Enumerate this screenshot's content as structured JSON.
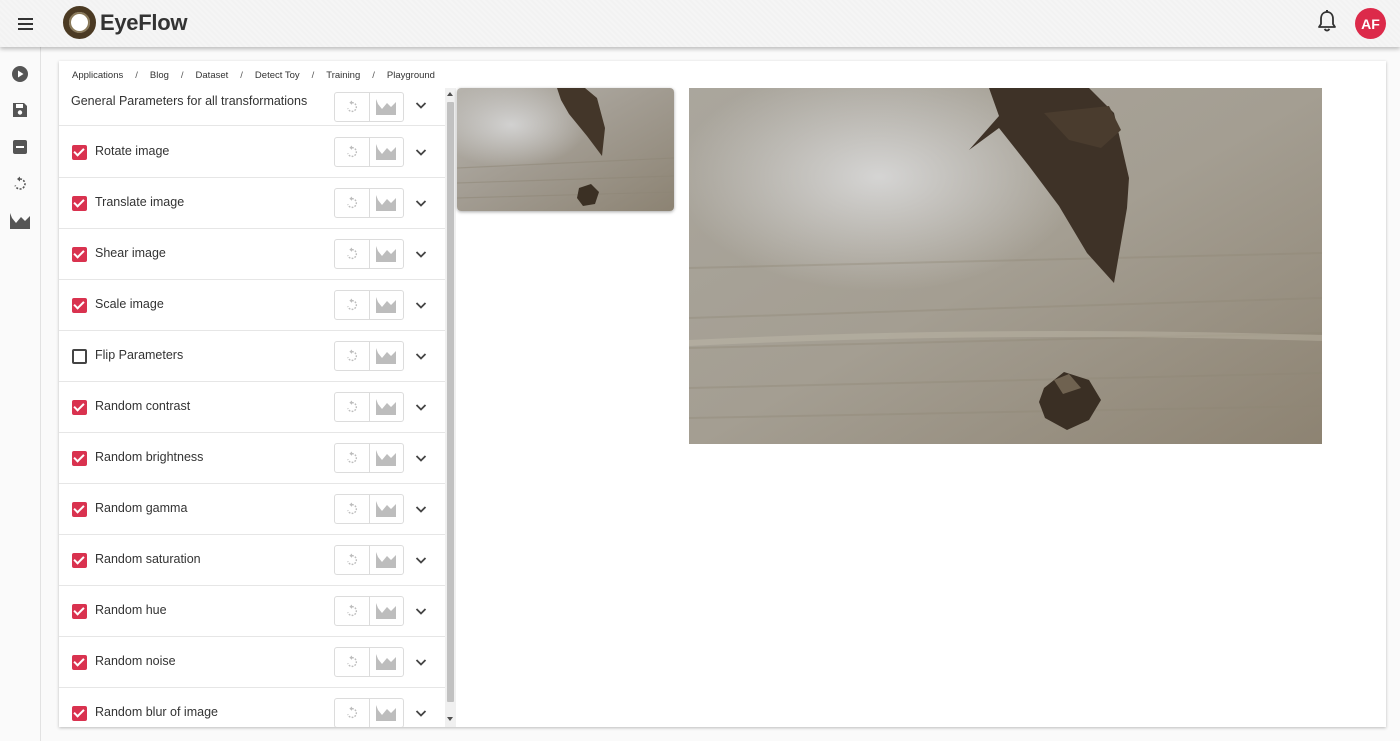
{
  "app": {
    "logo_text": "EyeFlow",
    "avatar_initials": "AF",
    "accent": "#d9324f",
    "avatar_color": "#dc2a4a"
  },
  "breadcrumb": [
    "Applications",
    "Blog",
    "Dataset",
    "Detect Toy",
    "Training",
    "Playground"
  ],
  "breadcrumb_separator": "/",
  "rail_icons": [
    "play-icon",
    "save-icon",
    "minus-box-icon",
    "reset-icon",
    "chart-icon"
  ],
  "transformations": {
    "header_label": "General Parameters for all transformations",
    "items": [
      {
        "label": "Rotate image",
        "checked": true
      },
      {
        "label": "Translate image",
        "checked": true
      },
      {
        "label": "Shear image",
        "checked": true
      },
      {
        "label": "Scale image",
        "checked": true
      },
      {
        "label": "Flip Parameters",
        "checked": false
      },
      {
        "label": "Random contrast",
        "checked": true
      },
      {
        "label": "Random brightness",
        "checked": true
      },
      {
        "label": "Random gamma",
        "checked": true
      },
      {
        "label": "Random saturation",
        "checked": true
      },
      {
        "label": "Random hue",
        "checked": true
      },
      {
        "label": "Random noise",
        "checked": true
      },
      {
        "label": "Random blur of image",
        "checked": true
      }
    ]
  }
}
